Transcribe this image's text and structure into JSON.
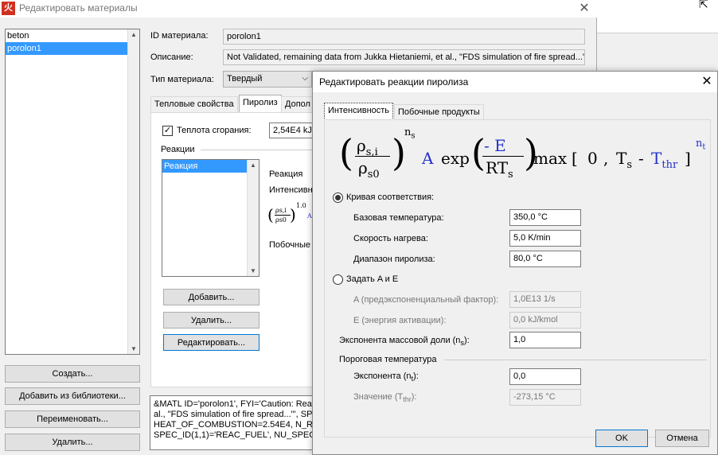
{
  "main_window": {
    "title": "Редактировать материалы",
    "close_glyph": "✕",
    "app_icon_glyph": "火"
  },
  "materials": [
    "beton",
    "porolon1"
  ],
  "selected_material": "porolon1",
  "left_buttons": {
    "create": "Создать...",
    "add_from_library": "Добавить из библиотеки...",
    "rename": "Переименовать...",
    "delete": "Удалить..."
  },
  "form": {
    "id_label": "ID материала:",
    "id_value": "porolon1",
    "desc_label": "Описание:",
    "desc_value": "Not Validated, remaining data from Jukka Hietaniemi, et al., \"FDS simulation of fire spread...\"",
    "type_label": "Тип материала:",
    "type_value": "Твердый"
  },
  "tabs": [
    "Тепловые свойства",
    "Пиролиз",
    "Допол"
  ],
  "pyrolysis": {
    "heat_label": "Теплота сгорания:",
    "heat_value": "2,54E4 kJ/",
    "reactions_label": "Реакции",
    "reactions": [
      "Реакция"
    ],
    "reaction_caption": "Реакция",
    "intensity_caption": "Интенсивн",
    "byproducts_caption": "Побочные",
    "mini_exp": "1.0",
    "mini_top": "ρs,i",
    "mini_bot": "ρs0",
    "mini_a": "A",
    "add": "Добавить...",
    "delete": "Удалить...",
    "edit": "Редактировать..."
  },
  "fds_text": [
    "&MATL ID='porolon1', FYI='Caution: Reac",
    "al., \"FDS simulation of fire spread...\"', SPE",
    "HEAT_OF_COMBUSTION=2.54E4, N_REAC",
    "SPEC_ID(1,1)='REAC_FUEL', NU_SPEC(1,"
  ],
  "dialog": {
    "title": "Редактировать реакции пиролиза",
    "close_glyph": "✕",
    "tabs": [
      "Интенсивность",
      "Побочные продукты"
    ],
    "formula": {
      "rho_si": "ρ",
      "si_sub": "s,i",
      "rho_s0": "ρ",
      "s0_sub": "s0",
      "ns": "n",
      "ns_sub": "s",
      "A": "A",
      "exp": "exp",
      "minus_E": "- E",
      "RT": "RT",
      "RT_sub": "s",
      "max": "max",
      "bracket_open": "[",
      "zero": "0",
      "comma": ",",
      "Ts": "T",
      "Ts_sub": "s",
      "minus": "-",
      "Tthr": "T",
      "Tthr_sub": "thr",
      "bracket_close": "]",
      "nt": "n",
      "nt_sub": "t"
    },
    "curve_fit_label": "Кривая соответствия:",
    "base_temp_label": "Базовая температура:",
    "base_temp_value": "350,0 °C",
    "heat_rate_label": "Скорость нагрева:",
    "heat_rate_value": "5,0 K/min",
    "pyro_range_label": "Диапазон пиролиза:",
    "pyro_range_value": "80,0 °C",
    "set_ae_label": "Задать A и E",
    "a_label": "A (предэкспоненциальный фактор):",
    "a_value": "1,0E13 1/s",
    "e_label": "E (энергия активации):",
    "e_value": "0,0 kJ/kmol",
    "mass_exp_label": "Экспонента массовой доли (n",
    "mass_exp_sub": "s",
    "mass_exp_tail": "):",
    "mass_exp_value": "1,0",
    "threshold_group": "Пороговая температура",
    "exponent_label": "Экспонента (n",
    "exponent_sub": "t",
    "exponent_tail": "):",
    "exponent_value": "0,0",
    "value_label": "Значение (T",
    "value_sub": "thr",
    "value_tail": "):",
    "value_value": "-273,15 °C",
    "ok": "OK",
    "cancel": "Отмена"
  }
}
